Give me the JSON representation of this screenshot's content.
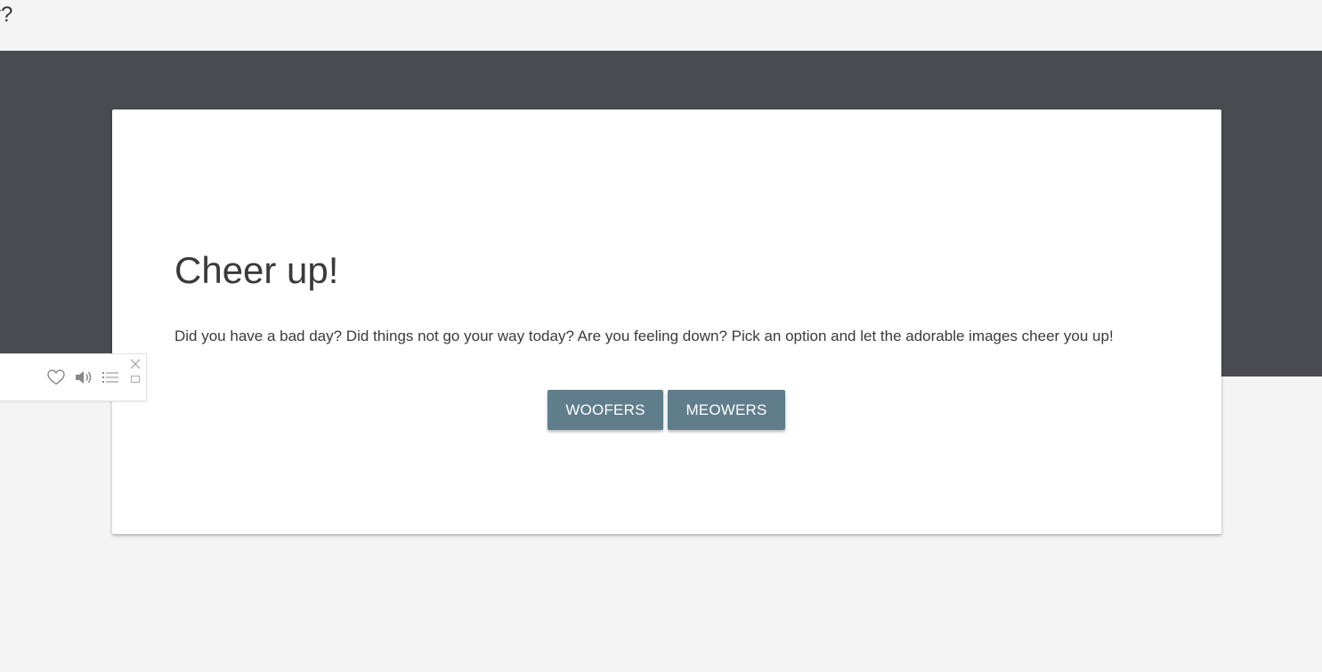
{
  "page": {
    "top_text": "y?"
  },
  "card": {
    "title": "Cheer up!",
    "description": "Did you have a bad day? Did things not go your way today? Are you feeling down? Pick an option and let the adorable images cheer you up!",
    "buttons": [
      {
        "label": "WOOFERS"
      },
      {
        "label": "MEOWERS"
      }
    ]
  },
  "player": {
    "icons": [
      "heart-icon",
      "speaker-icon",
      "list-icon",
      "close-icon",
      "minimize-icon"
    ]
  },
  "colors": {
    "background": "#f4f4f4",
    "dark_band": "#4a4b50",
    "card": "#ffffff",
    "button": "#607d8b",
    "text": "#3a3a3a"
  }
}
